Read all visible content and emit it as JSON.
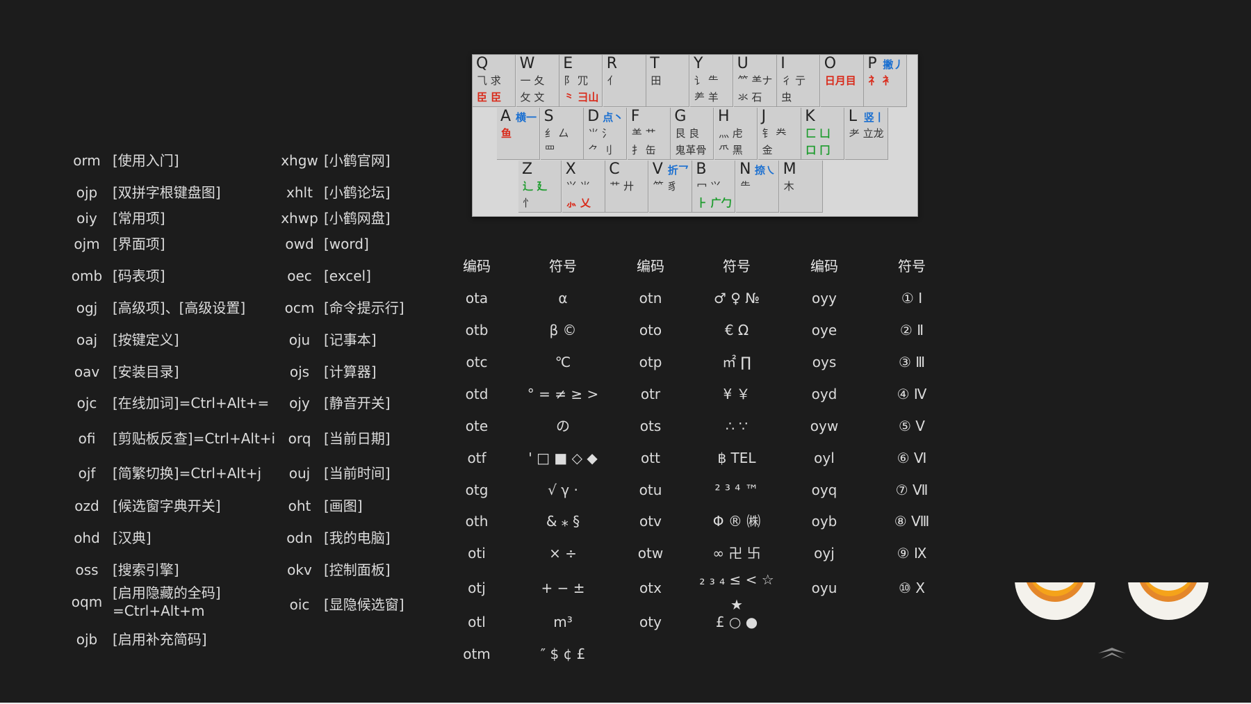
{
  "commands": {
    "left": [
      {
        "code": "orm",
        "label": "[使用入门]"
      },
      {
        "code": "ojp",
        "label": "[双拼字根键盘图]"
      },
      {
        "code": "oiy",
        "label": "[常用项]"
      },
      {
        "code": "ojm",
        "label": "[界面项]"
      },
      {
        "code": "omb",
        "label": "[码表项]"
      },
      {
        "code": "ogj",
        "label": "[高级项]、[高级设置]"
      },
      {
        "code": "oaj",
        "label": "[按键定义]"
      },
      {
        "code": "oav",
        "label": "[安装目录]"
      },
      {
        "code": "ojc",
        "label": "[在线加词]=Ctrl+Alt+="
      },
      {
        "code": "ofi",
        "label": "[剪贴板反查]=Ctrl+Alt+i"
      },
      {
        "code": "ojf",
        "label": "[简繁切换]=Ctrl+Alt+j"
      },
      {
        "code": "ozd",
        "label": "[候选窗字典开关]"
      },
      {
        "code": "ohd",
        "label": "[汉典]"
      },
      {
        "code": "oss",
        "label": "[搜索引擎]"
      },
      {
        "code": "oqm",
        "label": "[启用隐藏的全码]",
        "label2": "=Ctrl+Alt+m"
      },
      {
        "code": "ojb",
        "label": "[启用补充简码]"
      }
    ],
    "right": [
      {
        "code": "xhgw",
        "label": "[小鹤官网]"
      },
      {
        "code": "xhlt",
        "label": "[小鹤论坛]"
      },
      {
        "code": "xhwp",
        "label": "[小鹤网盘]"
      },
      {
        "code": "owd",
        "label": "[word]"
      },
      {
        "code": "oec",
        "label": "[excel]"
      },
      {
        "code": "ocm",
        "label": "[命令提示行]"
      },
      {
        "code": "oju",
        "label": "[记事本]"
      },
      {
        "code": "ojs",
        "label": "[计算器]"
      },
      {
        "code": "ojy",
        "label": "[静音开关]"
      },
      {
        "code": "orq",
        "label": "[当前日期]"
      },
      {
        "code": "ouj",
        "label": "[当前时间]"
      },
      {
        "code": "oht",
        "label": "[画图]"
      },
      {
        "code": "odn",
        "label": "[我的电脑]"
      },
      {
        "code": "okv",
        "label": "[控制面板]"
      },
      {
        "code": "oic",
        "label": "[显隐候选窗]"
      }
    ]
  },
  "keyboard": {
    "rows": [
      [
        {
          "k": "Q",
          "r1": "⺄ 求",
          "r2": "⾂ ⾂",
          "r2red": true
        },
        {
          "k": "W",
          "r1": "⼀ 夂",
          "r2": "攵 文"
        },
        {
          "k": "E",
          "r1": "阝 ⺴",
          "r2": "⺀ 彐山",
          "r2red": true
        },
        {
          "k": "R",
          "r1": "亻",
          "r2": ""
        },
        {
          "k": "T",
          "r1": "田",
          "r2": ""
        },
        {
          "k": "Y",
          "r1": "讠 ⺧",
          "r2": "⺶ 羊"
        },
        {
          "k": "U",
          "r1": "⺮ ⺷ナ",
          "r2": "氺 石"
        },
        {
          "k": "I",
          "r1": "彳 亍",
          "r2": "虫"
        },
        {
          "k": "O",
          "r1": "日月目",
          "r1red": true,
          "r2": ""
        },
        {
          "k": "P",
          "h": "撇丿",
          "r1": "礻 衤",
          "r1red": true,
          "r2": ""
        }
      ],
      [
        {
          "k": "A",
          "h": "横一",
          "r1": "鱼",
          "r1red": true,
          "r2": ""
        },
        {
          "k": "S",
          "r1": "纟 厶",
          "r2": "罒"
        },
        {
          "k": "D",
          "h": "点丶",
          "r1": "⺌ 氵",
          "r2": "⺈ 刂"
        },
        {
          "k": "F",
          "r1": "⺷ 艹",
          "r2": "扌 缶"
        },
        {
          "k": "G",
          "r1": "艮 良",
          "r2": "鬼革骨"
        },
        {
          "k": "H",
          "r1": "灬 虍",
          "r2": "⺥ 黑"
        },
        {
          "k": "J",
          "r1": "钅 龹",
          "r2": "金"
        },
        {
          "k": "K",
          "r1": "匚 凵",
          "r1grn": true,
          "r2": "口 冂",
          "r2grn": true
        },
        {
          "k": "L",
          "h": "竖丨",
          "r1": "⺹ 立龙",
          "r2": ""
        }
      ],
      [
        {
          "k": "Z",
          "r1": "辶 廴",
          "r1grn": true,
          "r2": "⺖"
        },
        {
          "k": "X",
          "r1": "⺍ ⺌",
          "r2": "⺗ 乂",
          "r2red": true
        },
        {
          "k": "C",
          "r1": "艹 廾",
          "r2": ""
        },
        {
          "k": "V",
          "h": "折乛",
          "r1": "⺮ 豸",
          "r2": ""
        },
        {
          "k": "B",
          "r1": "冖 ⺍",
          "r2": "⺊ 广勹",
          "r2grn": true
        },
        {
          "k": "N",
          "h": "捺㇏",
          "r1": "⺧",
          "r2": ""
        },
        {
          "k": "M",
          "r1": "木",
          "r2": ""
        }
      ]
    ]
  },
  "symbols": {
    "header_code": "编码",
    "header_symbol": "符号",
    "col1": [
      {
        "code": "ota",
        "sym": "α"
      },
      {
        "code": "otb",
        "sym": "β ©"
      },
      {
        "code": "otc",
        "sym": "℃"
      },
      {
        "code": "otd",
        "sym": "° = ≠ ≥ >"
      },
      {
        "code": "ote",
        "sym": "の"
      },
      {
        "code": "otf",
        "sym": "' □ ■ ◇ ◆"
      },
      {
        "code": "otg",
        "sym": "√ γ ·"
      },
      {
        "code": "oth",
        "sym": "& ⁎ §"
      },
      {
        "code": "oti",
        "sym": "× ÷"
      },
      {
        "code": "otj",
        "sym": "+ − ±"
      },
      {
        "code": "otl",
        "sym": "m³"
      },
      {
        "code": "otm",
        "sym": "″ $ ¢ £"
      }
    ],
    "col2": [
      {
        "code": "otn",
        "sym": "♂ ♀ №"
      },
      {
        "code": "oto",
        "sym": "€ Ω"
      },
      {
        "code": "otp",
        "sym": "㎡ ∏"
      },
      {
        "code": "otr",
        "sym": "¥ ￥"
      },
      {
        "code": "ots",
        "sym": "∴ ∵"
      },
      {
        "code": "ott",
        "sym": "฿ TEL"
      },
      {
        "code": "otu",
        "sym": "² ³ ⁴ ™"
      },
      {
        "code": "otv",
        "sym": "Φ ® ㈱"
      },
      {
        "code": "otw",
        "sym": "∞ 卍 卐"
      },
      {
        "code": "otx",
        "sym": "₂ ₃ ₄ ≤ < ☆",
        "sym2": "★"
      },
      {
        "code": "oty",
        "sym": "£ ○ ●"
      }
    ],
    "col3": [
      {
        "code": "oyy",
        "sym": "① Ⅰ"
      },
      {
        "code": "oye",
        "sym": "② Ⅱ"
      },
      {
        "code": "oys",
        "sym": "③ Ⅲ"
      },
      {
        "code": "oyd",
        "sym": "④ Ⅳ"
      },
      {
        "code": "oyw",
        "sym": "⑤ Ⅴ"
      },
      {
        "code": "oyl",
        "sym": "⑥ Ⅵ"
      },
      {
        "code": "oyq",
        "sym": "⑦ Ⅶ"
      },
      {
        "code": "oyb",
        "sym": "⑧ Ⅷ"
      },
      {
        "code": "oyj",
        "sym": "⑨ Ⅸ"
      },
      {
        "code": "oyu",
        "sym": "⑩ Ⅹ"
      }
    ]
  },
  "colors": {
    "background": "#1c1c1c",
    "eye_orange": "#f5a31a",
    "key_red": "#d92a1a",
    "key_blue": "#1a6fd0",
    "key_green": "#1e9c2e"
  }
}
